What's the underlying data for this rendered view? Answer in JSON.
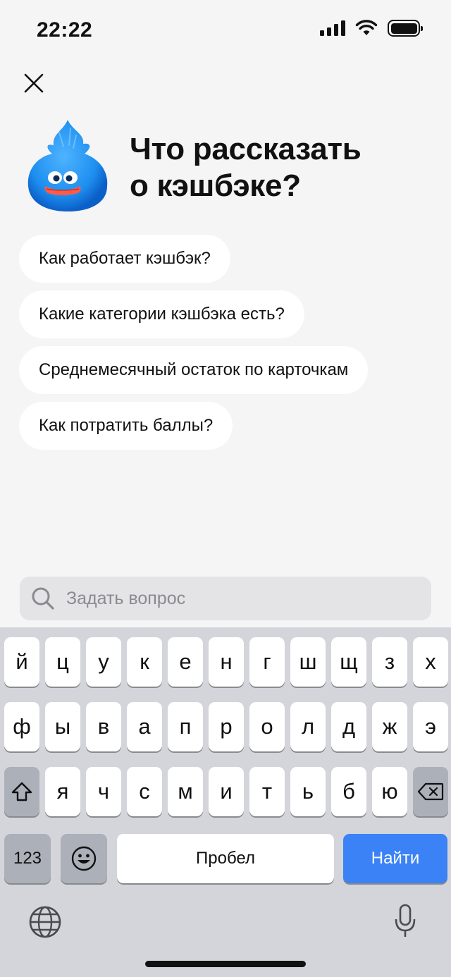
{
  "status": {
    "time": "22:22"
  },
  "header": {
    "title_line1": "Что рассказать",
    "title_line2": "о кэшбэке?"
  },
  "suggestions": [
    "Как работает кэшбэк?",
    "Какие категории кэшбэка есть?",
    "Среднемесячный остаток по карточкам",
    "Как потратить баллы?"
  ],
  "search": {
    "placeholder": "Задать вопрос",
    "value": ""
  },
  "keyboard": {
    "row1": [
      "й",
      "ц",
      "у",
      "к",
      "е",
      "н",
      "г",
      "ш",
      "щ",
      "з",
      "х"
    ],
    "row2": [
      "ф",
      "ы",
      "в",
      "а",
      "п",
      "р",
      "о",
      "л",
      "д",
      "ж",
      "э"
    ],
    "row3": [
      "я",
      "ч",
      "с",
      "м",
      "и",
      "т",
      "ь",
      "б",
      "ю"
    ],
    "numbers_label": "123",
    "space_label": "Пробел",
    "action_label": "Найти"
  },
  "colors": {
    "background": "#f5f5f6",
    "action": "#3a82f6",
    "keyboard": "#d3d5da",
    "mascot": "#1e8ff0"
  }
}
